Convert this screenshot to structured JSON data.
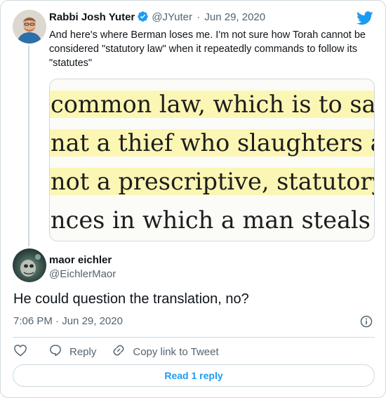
{
  "colors": {
    "accent": "#1d9bf0",
    "text": "#0f1419",
    "muted": "#536471",
    "border": "#cfd9de",
    "highlight": "#fbf6b4"
  },
  "quoted_tweet": {
    "name": "Rabbi Josh Yuter",
    "handle": "@JYuter",
    "separator": "·",
    "date": "Jun 29, 2020",
    "text": "And here's where Berman loses me. I'm not sure how Torah cannot be considered \"statutory law\" when it repeatedly commands to follow its \"statutes\"",
    "image_lines": [
      "common law, which is to say",
      "nat a thief who slaughters a",
      "not a prescriptive, statutory",
      "nces in which a man steals a"
    ]
  },
  "reply": {
    "name": "maor eichler",
    "handle": "@EichlerMaor",
    "text": "He could question the translation, no?",
    "time": "7:06 PM",
    "separator": "·",
    "date": "Jun 29, 2020"
  },
  "actions": {
    "reply_label": "Reply",
    "copy_label": "Copy link to Tweet"
  },
  "read_replies_label": "Read 1 reply",
  "icons": [
    "verified-badge-icon",
    "twitter-bird-icon",
    "info-icon",
    "heart-icon",
    "reply-icon",
    "link-icon"
  ]
}
